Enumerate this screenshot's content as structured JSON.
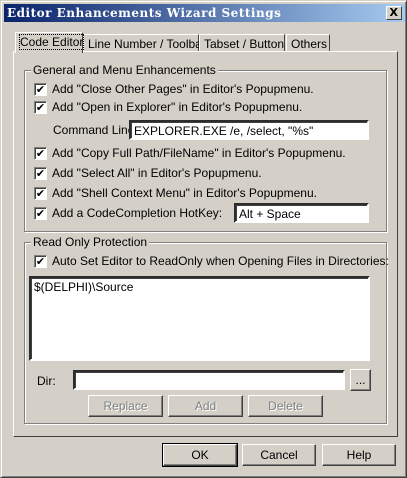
{
  "window": {
    "title": "Editor Enhancements Wizard Settings",
    "close": "X"
  },
  "tabs": [
    {
      "label": "Code Editor"
    },
    {
      "label": "Line Number / Toolbar"
    },
    {
      "label": "Tabset / Button"
    },
    {
      "label": "Others"
    }
  ],
  "general": {
    "title": "General and Menu Enhancements",
    "close_other": {
      "label": "Add \"Close Other Pages\" in Editor's Popupmenu.",
      "checked": true
    },
    "open_explorer": {
      "label": "Add \"Open in Explorer\" in Editor's Popupmenu.",
      "checked": true
    },
    "command_line": {
      "label": "Command Line:",
      "value": "EXPLORER.EXE /e, /select, \"%s\""
    },
    "copy_path": {
      "label": "Add \"Copy Full Path/FileName\" in Editor's Popupmenu.",
      "checked": true
    },
    "select_all": {
      "label": "Add \"Select All\" in Editor's Popupmenu.",
      "checked": true
    },
    "shell_menu": {
      "label": "Add \"Shell Context Menu\" in Editor's Popupmenu.",
      "checked": true
    },
    "hotkey": {
      "label": "Add a CodeCompletion HotKey:",
      "checked": true,
      "value": "Alt + Space"
    }
  },
  "readonly": {
    "title": "Read Only Protection",
    "auto_set": {
      "label": "Auto Set Editor to ReadOnly when Opening Files in Directories:",
      "checked": true
    },
    "dirs": [
      "$(DELPHI)\\Source"
    ],
    "dir_label": "Dir:",
    "dir_value": "",
    "browse": "...",
    "replace": "Replace",
    "add": "Add",
    "delete": "Delete"
  },
  "buttons": {
    "ok": "OK",
    "cancel": "Cancel",
    "help": "Help"
  },
  "check_glyph": "✔"
}
